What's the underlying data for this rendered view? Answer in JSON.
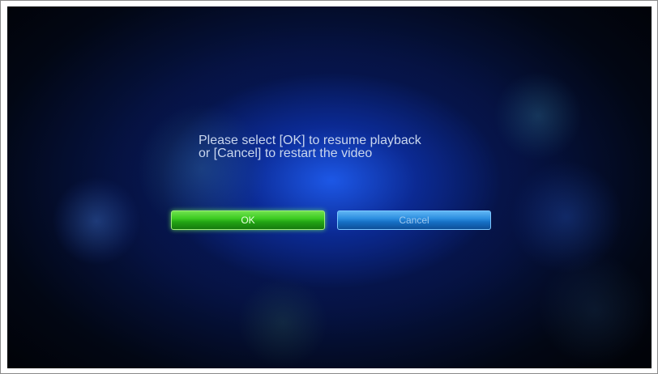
{
  "dialog": {
    "message_line1": "Please select [OK] to resume playback",
    "message_line2": "or [Cancel] to restart the video"
  },
  "buttons": {
    "ok_label": "OK",
    "cancel_label": "Cancel",
    "selected": "OK"
  },
  "colors": {
    "ok_button": "#3ccb22",
    "cancel_button": "#2d8fe0",
    "background": "#0b2a8c"
  }
}
